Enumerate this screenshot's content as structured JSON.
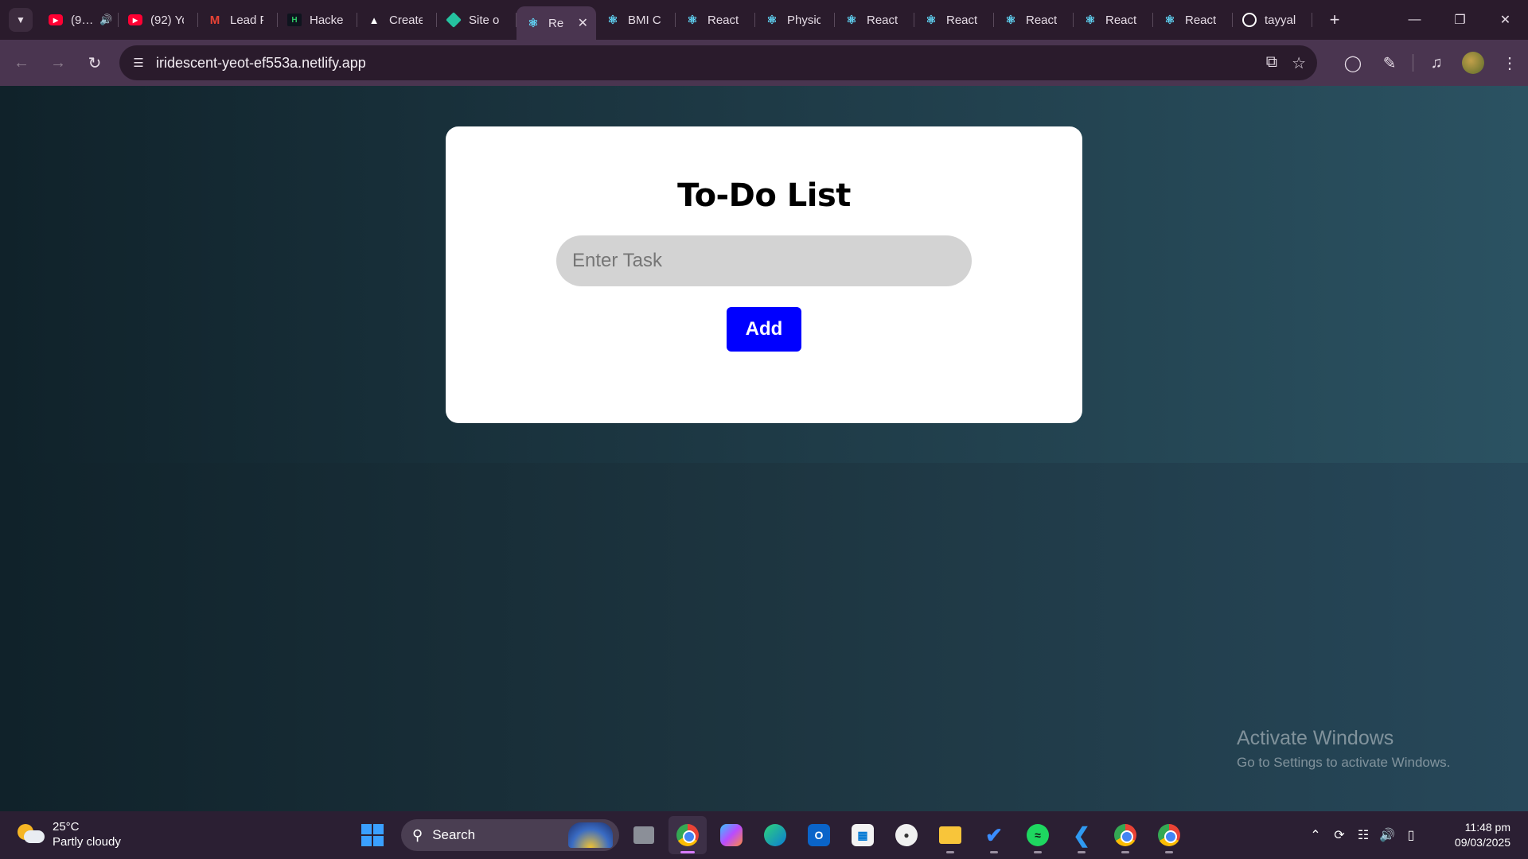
{
  "browser": {
    "tabs": [
      {
        "favicon": "youtube-icon",
        "title": "(9…",
        "audio": true
      },
      {
        "favicon": "youtube-icon",
        "title": "(92) Yo"
      },
      {
        "favicon": "gmail-icon",
        "title": "Lead F"
      },
      {
        "favicon": "hackerrank-icon",
        "title": "Hacke"
      },
      {
        "favicon": "triangle-icon",
        "title": "Create"
      },
      {
        "favicon": "netlify-icon",
        "title": "Site o"
      },
      {
        "favicon": "react-icon",
        "title": "Re",
        "active": true
      },
      {
        "favicon": "react-icon",
        "title": "BMI C"
      },
      {
        "favicon": "react-icon",
        "title": "React"
      },
      {
        "favicon": "react-icon",
        "title": "Physic"
      },
      {
        "favicon": "react-icon",
        "title": "React"
      },
      {
        "favicon": "react-icon",
        "title": "React"
      },
      {
        "favicon": "react-icon",
        "title": "React"
      },
      {
        "favicon": "react-icon",
        "title": "React"
      },
      {
        "favicon": "react-icon",
        "title": "React"
      },
      {
        "favicon": "github-icon",
        "title": "tayyal"
      }
    ],
    "url": "iridescent-yeot-ef553a.netlify.app"
  },
  "app": {
    "title": "To-Do List",
    "input_placeholder": "Enter Task",
    "input_value": "",
    "add_label": "Add"
  },
  "watermark": {
    "title": "Activate Windows",
    "subtitle": "Go to Settings to activate Windows."
  },
  "taskbar": {
    "weather_temp": "25°C",
    "weather_desc": "Partly cloudy",
    "search_label": "Search",
    "time": "11:48 pm",
    "date": "09/03/2025"
  },
  "colors": {
    "chrome_tabbar": "#2a1b2c",
    "chrome_toolbar": "#4a3550",
    "card_bg": "#ffffff",
    "input_bg": "#d3d3d3",
    "add_button": "#0000ff",
    "page_bg_start": "#10222a",
    "page_bg_end": "#2b5262"
  }
}
